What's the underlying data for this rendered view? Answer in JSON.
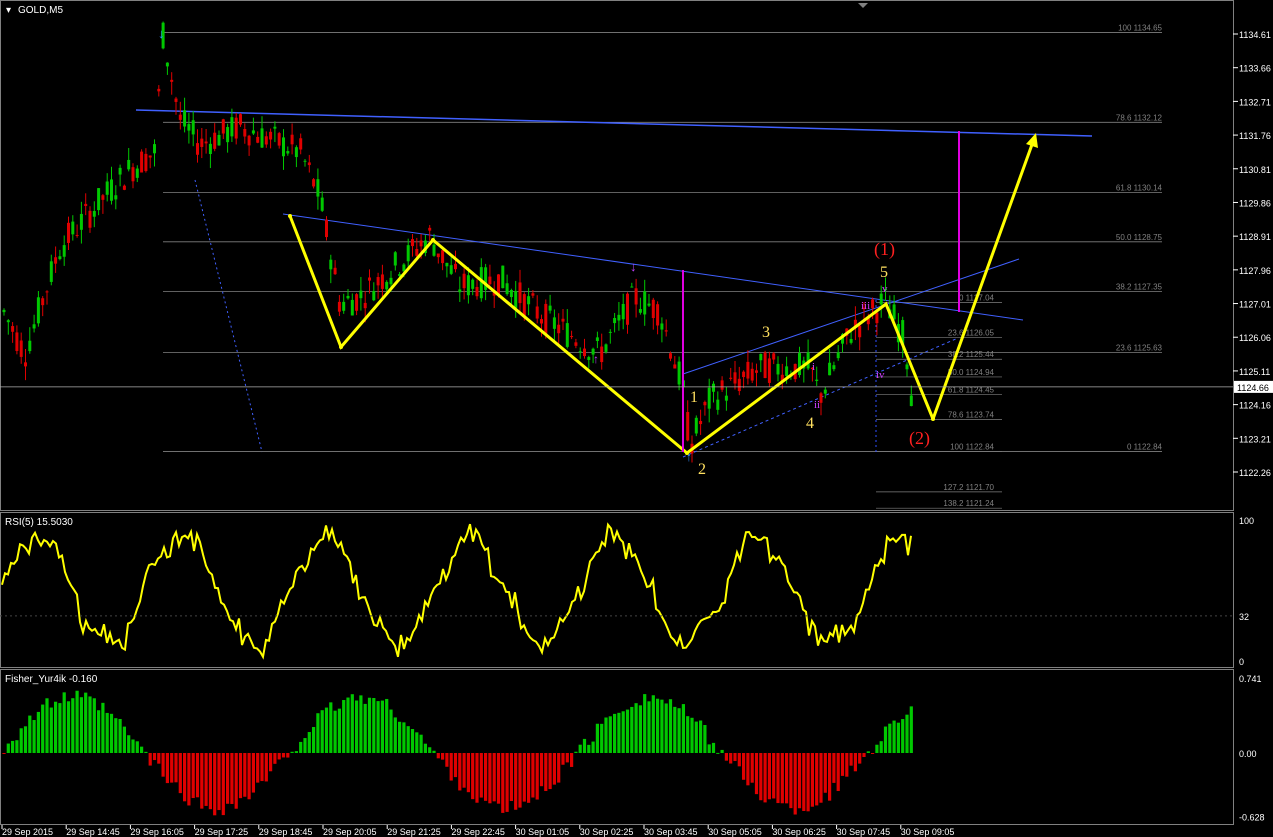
{
  "chart_data": [
    {
      "type": "candlestick",
      "title": "GOLD,M5",
      "symbol": "GOLD",
      "timeframe": "M5",
      "current_price": "1124.66",
      "price_ticks": [
        "1134.61",
        "1133.66",
        "1132.71",
        "1131.76",
        "1130.81",
        "1129.86",
        "1128.91",
        "1127.96",
        "1127.01",
        "1126.06",
        "1125.11",
        "1124.16",
        "1123.21",
        "1122.26"
      ],
      "ylim": [
        1121.9,
        1135.4
      ],
      "time_labels": [
        "29 Sep 2015",
        "29 Sep 14:45",
        "29 Sep 16:05",
        "29 Sep 17:25",
        "29 Sep 18:45",
        "29 Sep 20:05",
        "29 Sep 21:25",
        "29 Sep 22:45",
        "30 Sep 01:05",
        "30 Sep 02:25",
        "30 Sep 03:45",
        "30 Sep 05:05",
        "30 Sep 06:25",
        "30 Sep 07:45",
        "30 Sep 09:05"
      ],
      "fib_levels": [
        {
          "label": "100 1134.65",
          "price": 1134.65
        },
        {
          "label": "78.6 1132.12",
          "price": 1132.12
        },
        {
          "label": "61.8 1130.14",
          "price": 1130.14
        },
        {
          "label": "50.0 1128.75",
          "price": 1128.75
        },
        {
          "label": "38.2 1127.35",
          "price": 1127.35
        },
        {
          "label": "23.6 1125.63",
          "price": 1125.63
        },
        {
          "label": "0 1122.84",
          "price": 1122.84
        }
      ],
      "fib_levels_2": [
        {
          "label": "0 1127.04",
          "price": 1127.04
        },
        {
          "label": "23.6 1126.05",
          "price": 1126.05
        },
        {
          "label": "38.2 1125.44",
          "price": 1125.44
        },
        {
          "label": "50.0 1124.94",
          "price": 1124.94
        },
        {
          "label": "61.8 1124.45",
          "price": 1124.45
        },
        {
          "label": "78.6 1123.74",
          "price": 1123.74
        },
        {
          "label": "100 1122.84",
          "price": 1122.84
        },
        {
          "label": "127.2 1121.70",
          "price": 1121.7
        },
        {
          "label": "138.2 1121.24",
          "price": 1121.24
        }
      ],
      "wave_labels": {
        "impulse": [
          "1",
          "2",
          "3",
          "4",
          "5"
        ],
        "major": [
          "(1)",
          "(2)"
        ],
        "minor": [
          "i",
          "ii",
          "iii",
          "iv",
          "v"
        ]
      },
      "colors": {
        "bull": "#00c800",
        "bear": "#e00000",
        "zigzag": "#ffff00",
        "trend": "#4060ff",
        "fib": "#808080",
        "target": "#e000e0",
        "wave_major": "#ff2020"
      }
    },
    {
      "type": "line",
      "title": "RSI(5) 15.5030",
      "ticks": [
        "100",
        "32",
        "0"
      ],
      "ylim": [
        0,
        100
      ],
      "color": "#ffff00"
    },
    {
      "type": "histogram",
      "title": "Fisher_Yur4ik -0.160",
      "ticks": [
        "0.741",
        "0.00",
        "-0.628"
      ],
      "ylim": [
        -0.628,
        0.741
      ],
      "colors": {
        "positive": "#00c800",
        "negative": "#e00000"
      }
    }
  ]
}
